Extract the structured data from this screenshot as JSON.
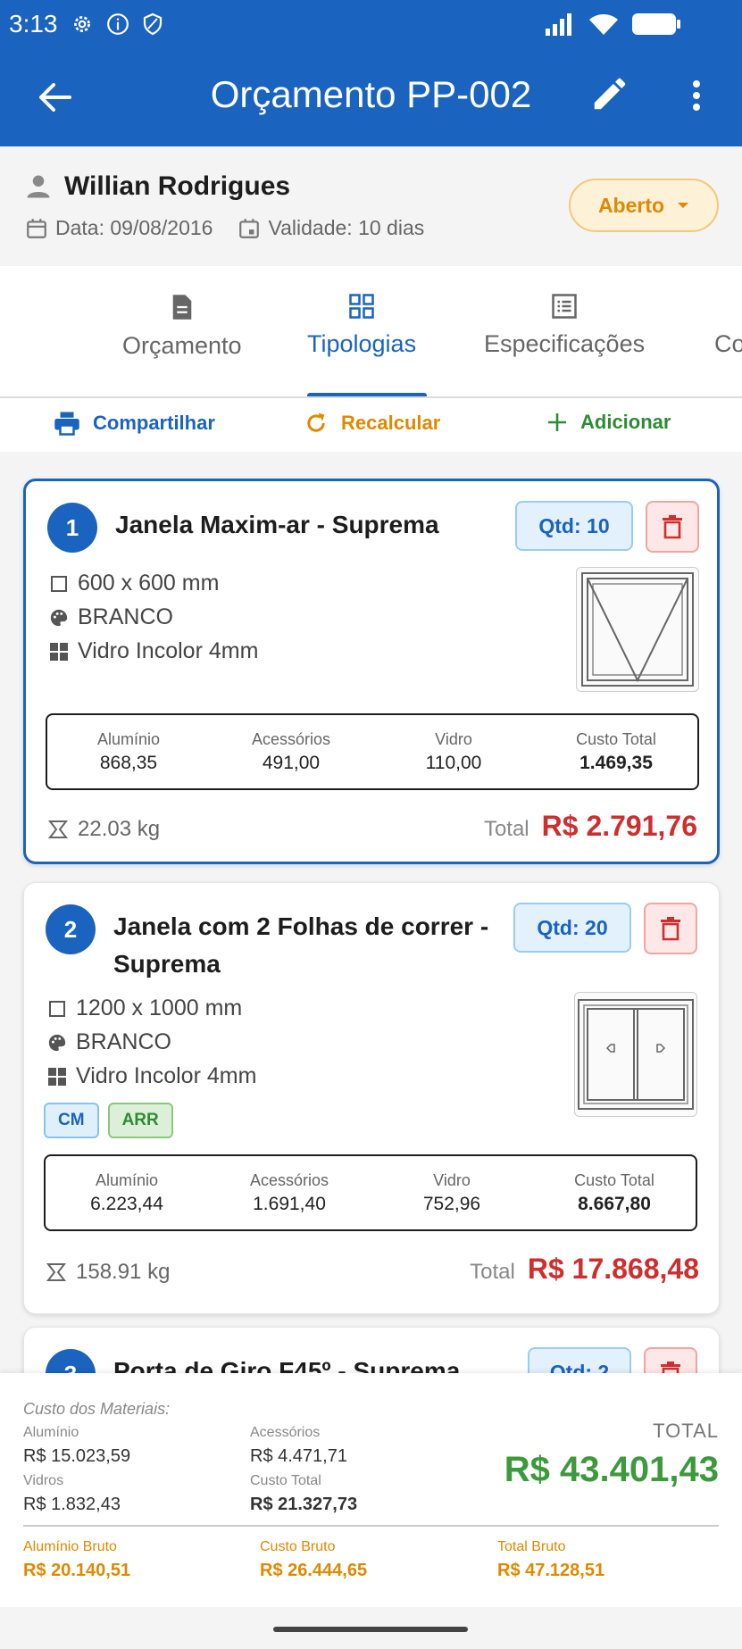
{
  "status_bar": {
    "time": "3:13"
  },
  "header": {
    "title": "Orçamento PP-002"
  },
  "client": {
    "name": "Willian Rodrigues",
    "date": "Data: 09/08/2016",
    "validity": "Validade: 10 dias",
    "status": "Aberto"
  },
  "tabs": [
    {
      "label": "Orçamento",
      "icon": "document-icon"
    },
    {
      "label": "Tipologias",
      "icon": "grid-icon",
      "active": true
    },
    {
      "label": "Especificações",
      "icon": "list-icon"
    },
    {
      "label": "Co"
    }
  ],
  "actions": {
    "share": "Compartilhar",
    "recalc": "Recalcular",
    "add": "Adicionar"
  },
  "colors": {
    "primary": "#1a63bf",
    "warning": "#e08800",
    "danger": "#cf2e2e",
    "success": "#3c9a3c"
  },
  "items": [
    {
      "number": "1",
      "title": "Janela Maxim-ar - Suprema",
      "qty": "Qtd: 10",
      "size": "600 x 600 mm",
      "color": "BRANCO",
      "glass": "Vidro Incolor 4mm",
      "costs": [
        {
          "label": "Alumínio",
          "value": "868,35"
        },
        {
          "label": "Acessórios",
          "value": "491,00"
        },
        {
          "label": "Vidro",
          "value": "110,00"
        },
        {
          "label": "Custo Total",
          "value": "1.469,35"
        }
      ],
      "weight": "22.03 kg",
      "total_label": "Total",
      "total": "R$  2.791,76"
    },
    {
      "number": "2",
      "title": "Janela com 2 Folhas de correr - Suprema",
      "qty": "Qtd: 20",
      "size": "1200 x 1000 mm",
      "color": "BRANCO",
      "glass": "Vidro Incolor 4mm",
      "tags": [
        "CM",
        "ARR"
      ],
      "costs": [
        {
          "label": "Alumínio",
          "value": "6.223,44"
        },
        {
          "label": "Acessórios",
          "value": "1.691,40"
        },
        {
          "label": "Vidro",
          "value": "752,96"
        },
        {
          "label": "Custo Total",
          "value": "8.667,80"
        }
      ],
      "weight": "158.91 kg",
      "total_label": "Total",
      "total": "R$  17.868,48"
    },
    {
      "number": "3",
      "title": "Porta de Giro F45º - Suprema",
      "qty": "Qtd: 2"
    }
  ],
  "summary": {
    "caption": "Custo dos Materiais:",
    "aluminio_label": "Alumínio",
    "aluminio": "R$  15.023,59",
    "acessorios_label": "Acessórios",
    "acessorios": "R$  4.471,71",
    "vidros_label": "Vidros",
    "vidros": "R$  1.832,43",
    "custo_total_label": "Custo Total",
    "custo_total": "R$  21.327,73",
    "total_label": "TOTAL",
    "total": "R$  43.401,43",
    "aluminio_bruto_label": "Alumínio Bruto",
    "aluminio_bruto": "R$  20.140,51",
    "custo_bruto_label": "Custo Bruto",
    "custo_bruto": "R$  26.444,65",
    "total_bruto_label": "Total Bruto",
    "total_bruto": "R$  47.128,51"
  }
}
